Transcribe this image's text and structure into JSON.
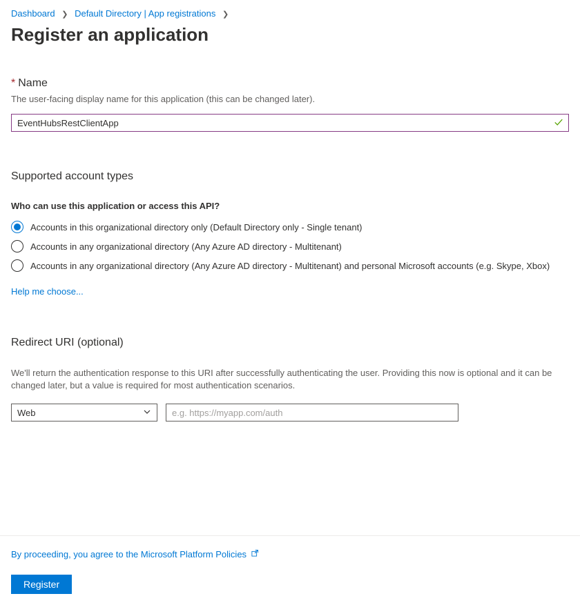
{
  "breadcrumb": {
    "dashboard": "Dashboard",
    "directory": "Default Directory | App registrations"
  },
  "page_title": "Register an application",
  "name_section": {
    "label": "Name",
    "desc": "The user-facing display name for this application (this can be changed later).",
    "value": "EventHubsRestClientApp"
  },
  "account_types": {
    "heading": "Supported account types",
    "question": "Who can use this application or access this API?",
    "options": [
      "Accounts in this organizational directory only (Default Directory only - Single tenant)",
      "Accounts in any organizational directory (Any Azure AD directory - Multitenant)",
      "Accounts in any organizational directory (Any Azure AD directory - Multitenant) and personal Microsoft accounts (e.g. Skype, Xbox)"
    ],
    "help_link": "Help me choose..."
  },
  "redirect_uri": {
    "heading": "Redirect URI (optional)",
    "desc": "We'll return the authentication response to this URI after successfully authenticating the user. Providing this now is optional and it can be changed later, but a value is required for most authentication scenarios.",
    "select_value": "Web",
    "placeholder": "e.g. https://myapp.com/auth"
  },
  "footer": {
    "policy_text": "By proceeding, you agree to the Microsoft Platform Policies",
    "register_label": "Register"
  }
}
